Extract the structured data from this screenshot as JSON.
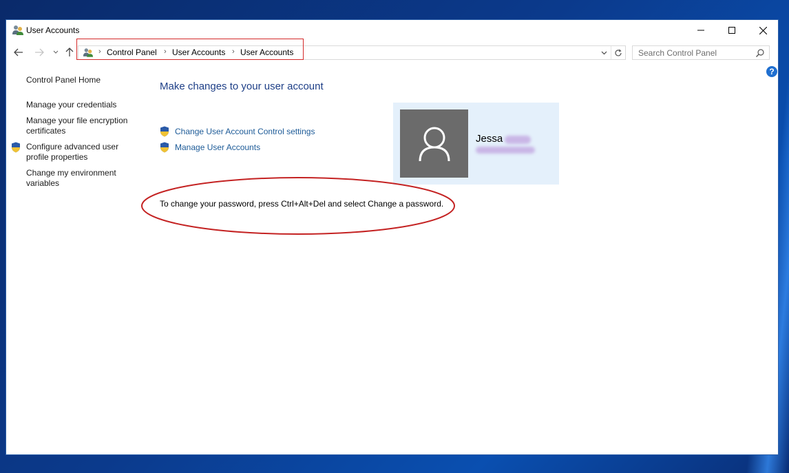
{
  "window": {
    "title": "User Accounts"
  },
  "titlebar": {
    "minimize_icon": "minimize-icon",
    "maximize_icon": "maximize-icon",
    "close_icon": "close-icon"
  },
  "address_bar": {
    "breadcrumbs": [
      "Control Panel",
      "User Accounts",
      "User Accounts"
    ],
    "separator": "›"
  },
  "search": {
    "placeholder": "Search Control Panel"
  },
  "sidebar": {
    "items": [
      {
        "label": "Control Panel Home"
      },
      {
        "label": "Manage your credentials"
      },
      {
        "label": "Manage your file encryption certificates"
      },
      {
        "label": "Configure advanced user profile properties",
        "icon": "uac-shield-icon"
      },
      {
        "label": "Change my environment variables"
      }
    ]
  },
  "main": {
    "heading": "Make changes to your user account",
    "tasks": [
      {
        "label": "Change User Account Control settings",
        "icon": "uac-shield-icon"
      },
      {
        "label": "Manage User Accounts",
        "icon": "uac-shield-icon"
      }
    ],
    "info": "To change your password, press Ctrl+Alt+Del and select Change a password."
  },
  "user": {
    "name": "Jessa"
  },
  "help": {
    "label": "?"
  },
  "colors": {
    "link": "#1c5a97",
    "heading": "#1e3f87",
    "annotation_red": "#d42a2a",
    "tile_bg": "#e4f0fb",
    "avatar_bg": "#6b6b6b"
  }
}
